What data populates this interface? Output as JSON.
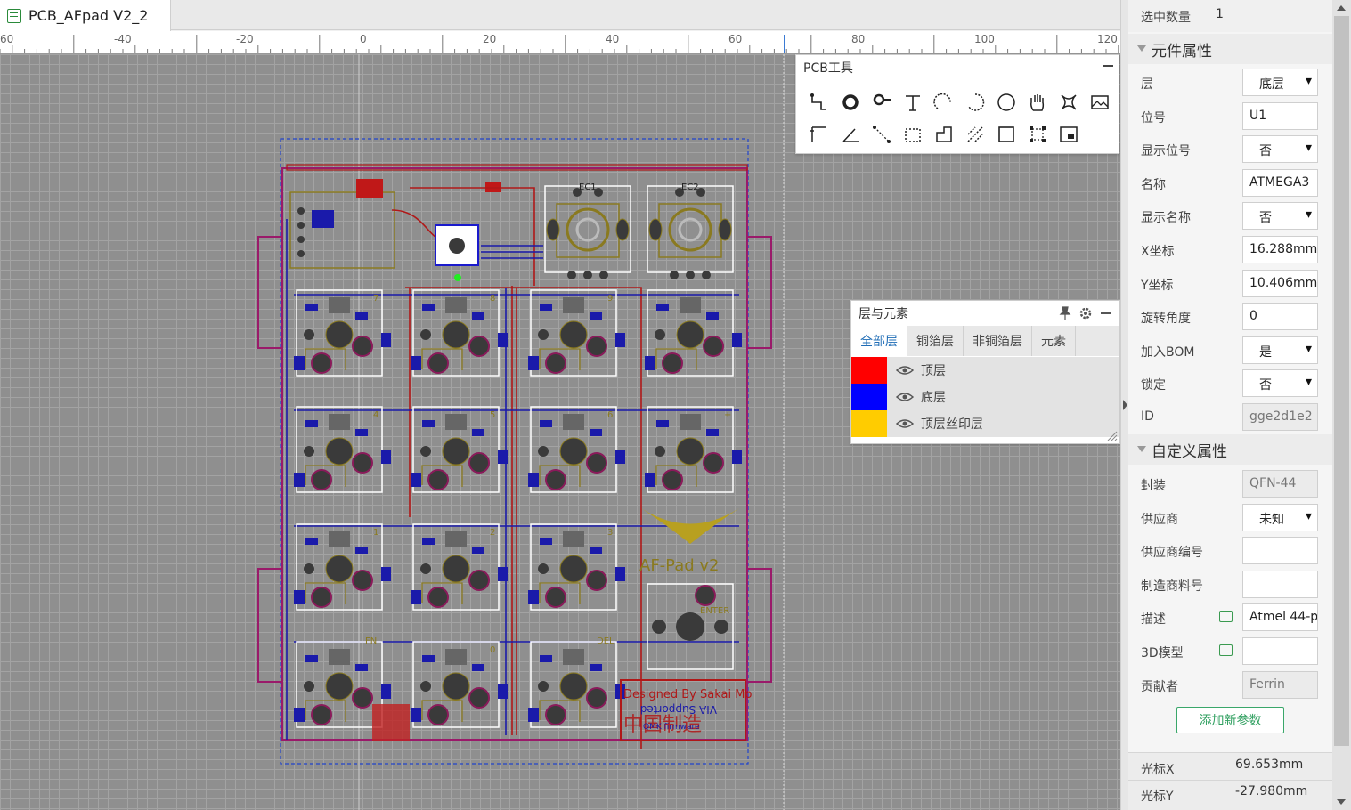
{
  "tab": {
    "title": "PCB_AFpad V2_2"
  },
  "ruler": {
    "labels": [
      "60",
      "-40",
      "-20",
      "0",
      "20",
      "40",
      "60",
      "80",
      "100",
      "120"
    ]
  },
  "pcb_tools": {
    "title": "PCB工具",
    "tools": [
      "track-icon",
      "via-icon",
      "pad-icon",
      "text-icon",
      "arc-icon",
      "arc-center-icon",
      "circle-icon",
      "pan-hand-icon",
      "connect-pads-icon",
      "image-icon",
      "dimension-icon",
      "angle-icon",
      "connector-icon",
      "rect-select-icon",
      "outline-icon",
      "copper-fill-icon",
      "rectangle-icon",
      "group-icon",
      "board-outline-icon"
    ]
  },
  "layers_panel": {
    "title": "层与元素",
    "tabs": [
      "全部层",
      "铜箔层",
      "非铜箔层",
      "元素"
    ],
    "rows": [
      {
        "name": "顶层",
        "color": "#ff0000"
      },
      {
        "name": "底层",
        "color": "#0000ff"
      },
      {
        "name": "顶层丝印层",
        "color": "#ffcc00"
      }
    ]
  },
  "props": {
    "selected_count_label": "选中数量",
    "selected_count": "1",
    "component_section": "元件属性",
    "custom_section": "自定义属性",
    "add_param": "添加新参数",
    "cursor_x_label": "光标X",
    "cursor_x": "69.653mm",
    "cursor_y_label": "光标Y",
    "cursor_y": "-27.980mm",
    "component": [
      {
        "label": "层",
        "value": "底层",
        "kind": "select"
      },
      {
        "label": "位号",
        "value": "U1",
        "kind": "text"
      },
      {
        "label": "显示位号",
        "value": "否",
        "kind": "select"
      },
      {
        "label": "名称",
        "value": "ATMEGA3",
        "kind": "text"
      },
      {
        "label": "显示名称",
        "value": "否",
        "kind": "select"
      },
      {
        "label": "X坐标",
        "value": "16.288mm",
        "kind": "text"
      },
      {
        "label": "Y坐标",
        "value": "10.406mm",
        "kind": "text"
      },
      {
        "label": "旋转角度",
        "value": "0",
        "kind": "text"
      },
      {
        "label": "加入BOM",
        "value": "是",
        "kind": "select"
      },
      {
        "label": "锁定",
        "value": "否",
        "kind": "select"
      },
      {
        "label": "ID",
        "value": "gge2d1e2",
        "kind": "disabled"
      }
    ],
    "custom": [
      {
        "label": "封装",
        "value": "QFN-44",
        "kind": "disabled"
      },
      {
        "label": "供应商",
        "value": "未知",
        "kind": "select"
      },
      {
        "label": "供应商编号",
        "value": "",
        "kind": "text"
      },
      {
        "label": "制造商料号",
        "value": "",
        "kind": "text"
      },
      {
        "label": "描述",
        "value": "Atmel 44-p",
        "kind": "text",
        "editable": true
      },
      {
        "label": "3D模型",
        "value": "",
        "kind": "text",
        "editable": true
      },
      {
        "label": "贡献者",
        "value": "Ferrin",
        "kind": "disabled"
      }
    ]
  },
  "board": {
    "silk_text_1": "Designed By Sakai Mo",
    "silk_text_2": "VIA Supported",
    "silk_text_3": "QMK firmware",
    "silk_logo_text": "中国制造",
    "model_text": "AF-Pad v2",
    "enter_label": "ENTER",
    "fn_label": "FN",
    "del_label": "DEL",
    "key_numbers": [
      "7",
      "8",
      "9",
      "",
      "4",
      "5",
      "6",
      "+",
      "1",
      "2",
      "3",
      "",
      "",
      "0",
      "",
      ""
    ],
    "encoder_labels": [
      "EC1",
      "EC2"
    ]
  },
  "colors": {
    "accent_blue": "#1e6cb6",
    "accent_green": "#2f9f5f"
  }
}
